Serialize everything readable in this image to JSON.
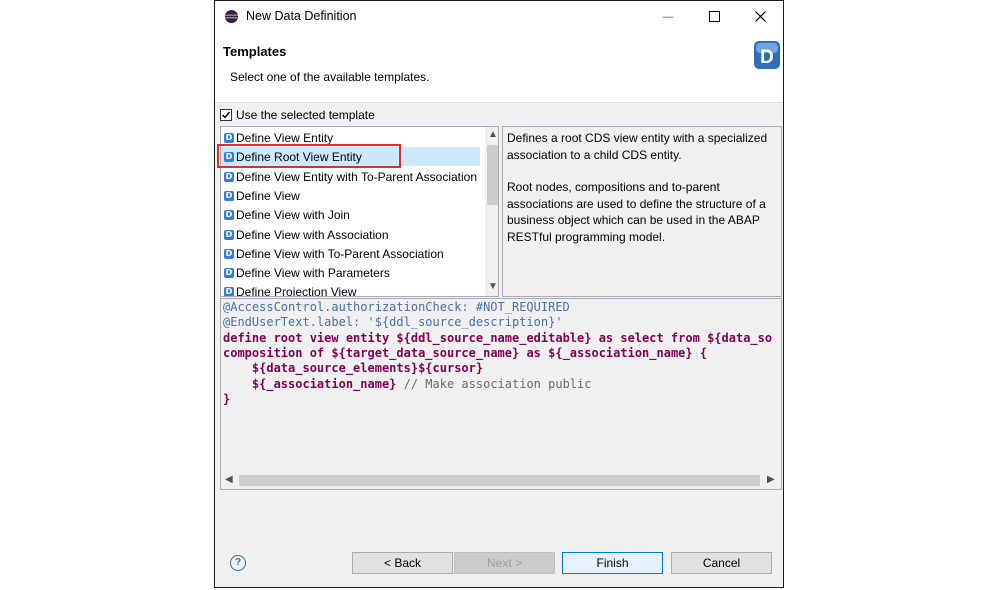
{
  "window": {
    "title": "New Data Definition",
    "minimize_glyph": "—",
    "maximize_glyph": "☐",
    "close_glyph": "✕"
  },
  "header": {
    "title": "Templates",
    "description": "Select one of the available templates.",
    "logo_letter": "D"
  },
  "use_template": {
    "label": "Use the selected template",
    "checked": true
  },
  "templates": {
    "items": [
      {
        "label": "Define View Entity"
      },
      {
        "label": "Define Root View Entity"
      },
      {
        "label": "Define View Entity with To-Parent Association"
      },
      {
        "label": "Define View"
      },
      {
        "label": "Define View with Join"
      },
      {
        "label": "Define View with Association"
      },
      {
        "label": "Define View with To-Parent Association"
      },
      {
        "label": "Define View with Parameters"
      },
      {
        "label": "Define Projection View"
      }
    ],
    "selected": "Define Root View Entity"
  },
  "description": {
    "paragraph1": "Defines a root CDS view entity with a specialized association to a child CDS entity.",
    "paragraph2": "Root nodes, compositions and to-parent associations are used to define the structure of a business object which can be used in the ABAP RESTful programming model."
  },
  "code": {
    "line1": "@AccessControl.authorizationCheck: #NOT_REQUIRED",
    "line2": "@EndUserText.label: '${ddl_source_description}'",
    "line3_kw1": "define root view entity",
    "line3_var1": " ${ddl_source_name_editable} ",
    "line3_kw2": "as select from",
    "line3_var2": " ${data_so",
    "line4_kw1": "composition of",
    "line4_var1": " ${target_data_source_name} ",
    "line4_kw2": "as",
    "line4_var2": " ${_association_name} {",
    "line5": "    ${data_source_elements}${cursor}",
    "line6_var": "    ${_association_name} ",
    "line6_comment": "// Make association public",
    "line7": "}"
  },
  "buttons": {
    "back": "< Back",
    "next": "Next >",
    "finish": "Finish",
    "cancel": "Cancel",
    "help_glyph": "?"
  },
  "colors": {
    "highlight": "#d9302c",
    "selection": "#cce8ff",
    "keyword": "#7f0055",
    "annotation": "#4a6fa5"
  }
}
